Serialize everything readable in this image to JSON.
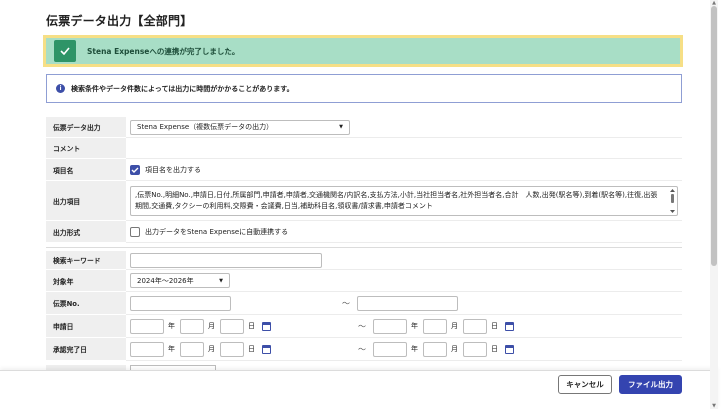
{
  "page": {
    "title": "伝票データ出力【全部門】"
  },
  "alerts": {
    "success": "Stena Expenseへの連携が完了しました。",
    "info": "検索条件やデータ件数によっては出力に時間がかかることがあります。"
  },
  "form": {
    "output_type": {
      "label": "伝票データ出力",
      "value": "Stena Expense（複数伝票データの出力）"
    },
    "comment": {
      "label": "コメント"
    },
    "item_name": {
      "label": "項目名",
      "checkbox_label": "項目名を出力する",
      "checked": true
    },
    "output_items": {
      "label": "出力項目",
      "value": ",伝票No.,明細No.,申請日,日付,所属部門,申請者,申請者,交通機関名/内訳名,支払方法,小計,当社担当者名,社外担当者名,合計　人数,出発(駅名等),到着(駅名等),往復,出張期間,交通費,タクシーの利用料,交際費・会議費,日当,補助科目名,領収書/請求書,申請者コメント"
    },
    "output_format": {
      "label": "出力形式",
      "checkbox_label": "出力データをStena Expenseに自動連携する",
      "checked": false
    },
    "keyword": {
      "label": "検索キーワード",
      "value": ""
    },
    "target_year": {
      "label": "対象年",
      "value": "2024年～2026年"
    },
    "slip_no": {
      "label": "伝票No.",
      "separator": "～"
    },
    "apply_date": {
      "label": "申請日",
      "separator": "～"
    },
    "approval_date": {
      "label": "承認完了日",
      "separator": "～"
    },
    "date_units": {
      "year": "年",
      "month": "月",
      "day": "日"
    }
  },
  "footer": {
    "cancel_label": "キャンセル",
    "export_label": "ファイル出力"
  },
  "colors": {
    "accent": "#3444b0",
    "success_bg": "#a8dec6",
    "success_border": "#f6df86",
    "success_icon": "#2e9467"
  }
}
